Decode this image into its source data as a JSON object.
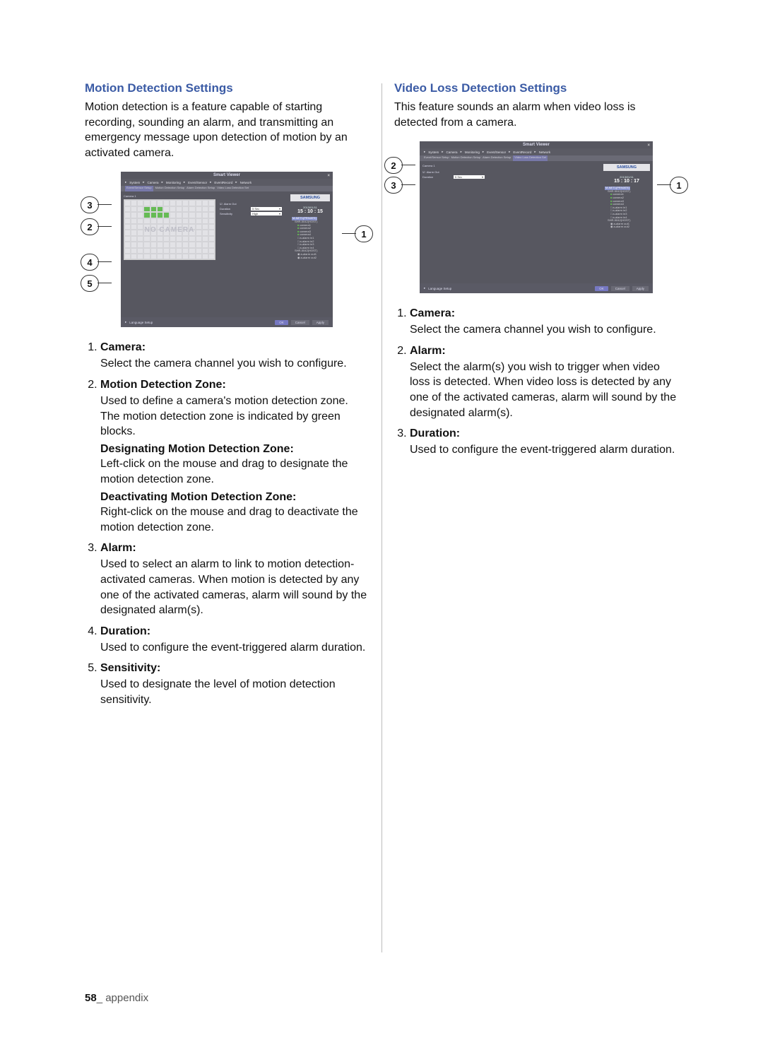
{
  "left": {
    "section_title": "Motion Detection Settings",
    "intro": "Motion detection is a feature capable of starting recording, sounding an alarm, and transmitting an emergency message upon detection of motion by an activated camera.",
    "items": [
      {
        "term": "Camera",
        "body": "Select the camera channel you wish to configure."
      },
      {
        "term": "Motion Detection Zone",
        "body": "Used to define a camera's motion detection zone. The motion detection zone is indicated by green blocks.",
        "sub": [
          {
            "term": "Designating Motion Detection Zone",
            "body": "Left-click on the mouse and drag to designate the motion detection zone."
          },
          {
            "term": "Deactivating Motion Detection Zone",
            "body": "Right-click on the mouse and drag to deactivate the motion detection zone."
          }
        ]
      },
      {
        "term": "Alarm",
        "body": "Used to select an alarm to link to motion detection-activated cameras. When motion is detected by any one of the activated cameras, alarm will sound by the designated alarm(s)."
      },
      {
        "term": "Duration",
        "body": "Used to configure the event-triggered alarm duration."
      },
      {
        "term": "Sensitivity",
        "body": "Used to designate the level of motion detection sensitivity."
      }
    ]
  },
  "right": {
    "section_title": "Video Loss Detection Settings",
    "intro": "This feature sounds an alarm when video loss is detected from a camera.",
    "items": [
      {
        "term": "Camera",
        "body": "Select the camera channel you wish to configure."
      },
      {
        "term": "Alarm",
        "body": "Select the alarm(s) you wish to trigger when video loss is detected. When video loss is detected by any one of the activated cameras, alarm will sound by the designated alarm(s)."
      },
      {
        "term": "Duration",
        "body": "Used to configure the event-triggered alarm duration."
      }
    ]
  },
  "screenshot": {
    "title": "Smart Viewer",
    "tabs": [
      "System",
      "Camera",
      "Monitoring",
      "Event/Sensor",
      "EventRecord",
      "Network"
    ],
    "subtabs": [
      "Event/Sensor Setup",
      "Motion Detection Setup",
      "Alarm Detection Setup",
      "Video Loss Detection Set"
    ],
    "camera_label": "Camera 1",
    "alarm_out_label": "Alarm Out",
    "duration_label": "Duration",
    "duration_value": "5 Sec",
    "sensitivity_label": "Sensitivity",
    "sensitivity_value": "High",
    "logo": "SAMSUNG",
    "date_left": "2013/01/11",
    "time_left": "15 : 10 : 15",
    "date_right": "2013/01/11",
    "time_right": "15 : 10 : 17",
    "footer_lang": "Language Setup",
    "footer_ok": "OK",
    "footer_cancel": "Cancel",
    "footer_apply": "Apply",
    "no_camera": "NO CAMERA",
    "tree_root_a": "M-NET1(PRIVATE)",
    "tree_root_b": "SHR-5042(HOST)",
    "tree_cams": [
      "camera1",
      "camera2",
      "camera3",
      "camera4"
    ],
    "tree_alarms": [
      "a-alarm in1",
      "a-alarm in2",
      "a-alarm in3",
      "a-alarm in4"
    ],
    "tree_out": [
      "a-alarm out1",
      "a-alarm out2"
    ]
  },
  "callouts": {
    "c1": "1",
    "c2": "2",
    "c3": "3",
    "c4": "4",
    "c5": "5"
  },
  "footer": {
    "page": "58",
    "section": "_ appendix"
  }
}
